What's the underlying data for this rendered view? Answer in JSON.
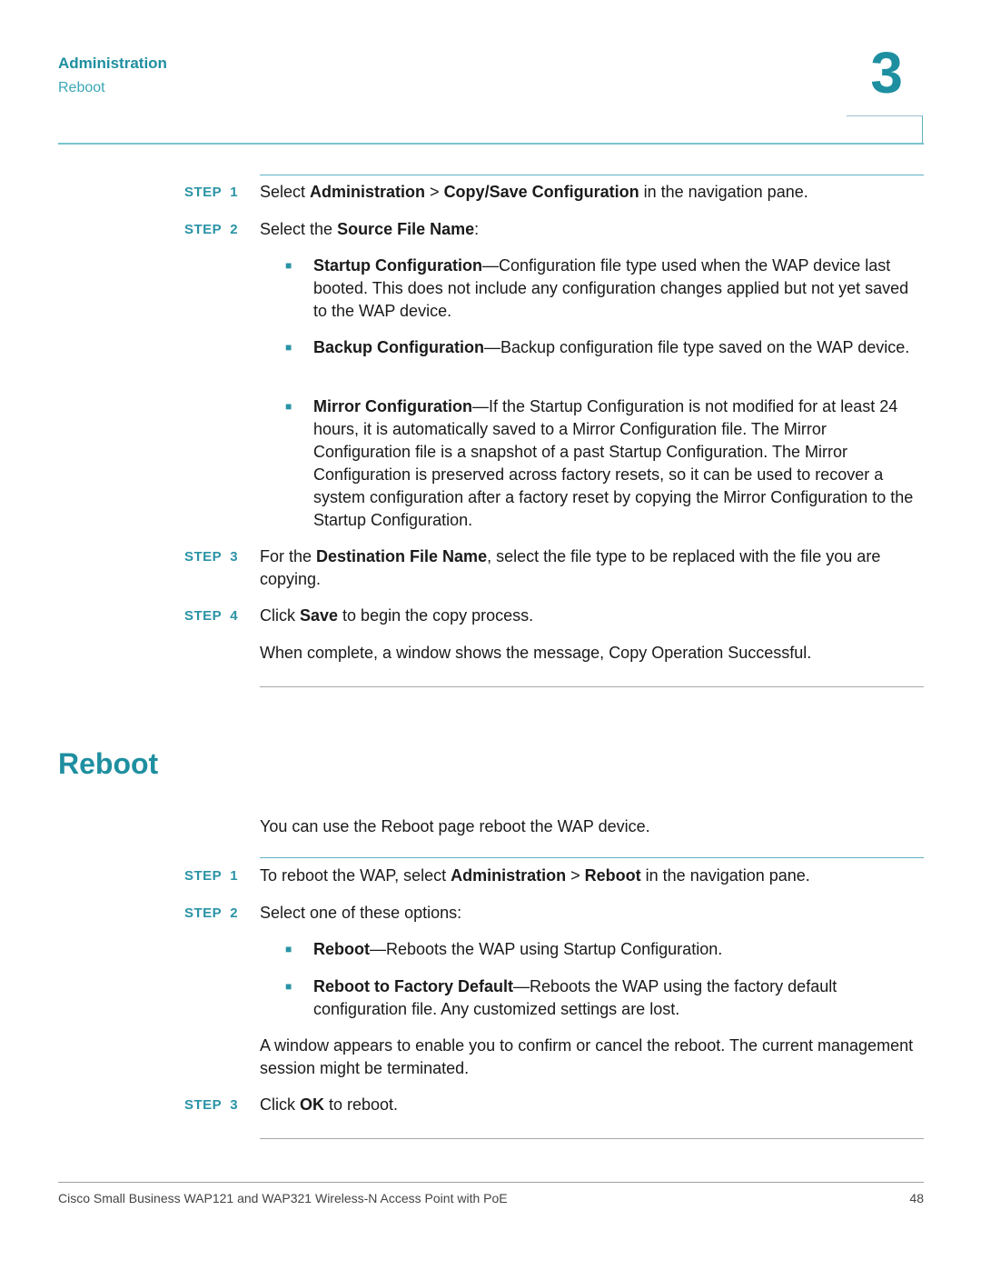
{
  "header": {
    "chapter_title": "Administration",
    "section_title": "Reboot",
    "chapter_number": "3"
  },
  "copy_save": {
    "steps": [
      {
        "label": "STEP  1",
        "parts": [
          {
            "t": "Select ",
            "b": false
          },
          {
            "t": "Administration",
            "b": true
          },
          {
            "t": " > ",
            "b": false
          },
          {
            "t": "Copy/Save Configuration",
            "b": true
          },
          {
            "t": " in the navigation pane.",
            "b": false
          }
        ]
      },
      {
        "label": "STEP  2",
        "parts": [
          {
            "t": "Select the ",
            "b": false
          },
          {
            "t": "Source File Name",
            "b": true
          },
          {
            "t": ":",
            "b": false
          }
        ]
      },
      {
        "label": "STEP  3",
        "parts": [
          {
            "t": "For the ",
            "b": false
          },
          {
            "t": "Destination File Name",
            "b": true
          },
          {
            "t": ", select the file type to be replaced with the file you are copying.",
            "b": false
          }
        ]
      },
      {
        "label": "STEP  4",
        "parts": [
          {
            "t": "Click ",
            "b": false
          },
          {
            "t": "Save",
            "b": true
          },
          {
            "t": " to begin the copy process.",
            "b": false
          }
        ]
      }
    ],
    "bullets": [
      {
        "term": "Startup Configuration",
        "desc": "—Configuration file type used when the WAP device last booted. This does not include any configuration changes applied but not yet saved to the WAP device."
      },
      {
        "term": "Backup Configuration",
        "desc": "—Backup configuration file type saved on the WAP device."
      },
      {
        "term": "Mirror Configuration",
        "desc": "—If the Startup Configuration is not modified for at least 24 hours, it is automatically saved to a Mirror Configuration file. The Mirror Configuration file is a snapshot of a past Startup Configuration. The Mirror Configuration is preserved across factory resets, so it can be used to recover a system configuration after a factory reset by copying the Mirror Configuration to the Startup Configuration."
      }
    ],
    "completion_note": "When complete, a window shows the message, Copy Operation Successful."
  },
  "reboot": {
    "title": "Reboot",
    "intro": "You can use the Reboot page reboot the WAP device.",
    "steps": [
      {
        "label": "STEP  1",
        "parts": [
          {
            "t": "To reboot the WAP, select ",
            "b": false
          },
          {
            "t": "Administration",
            "b": true
          },
          {
            "t": " > ",
            "b": false
          },
          {
            "t": "Reboot",
            "b": true
          },
          {
            "t": " in the navigation pane.",
            "b": false
          }
        ]
      },
      {
        "label": "STEP  2",
        "parts": [
          {
            "t": "Select one of these options:",
            "b": false
          }
        ]
      },
      {
        "label": "STEP  3",
        "parts": [
          {
            "t": "Click ",
            "b": false
          },
          {
            "t": "OK",
            "b": true
          },
          {
            "t": " to reboot.",
            "b": false
          }
        ]
      }
    ],
    "bullets": [
      {
        "term": "Reboot",
        "desc": "—Reboots the WAP using Startup Configuration."
      },
      {
        "term": "Reboot to Factory Default",
        "desc": "—Reboots the WAP using the factory default configuration file. Any customized settings are lost."
      }
    ],
    "confirm_note": "A window appears to enable you to confirm or cancel the reboot. The current management session might be terminated."
  },
  "footer": {
    "text": "Cisco Small Business WAP121 and WAP321 Wireless-N Access Point with PoE",
    "page_number": "48"
  }
}
